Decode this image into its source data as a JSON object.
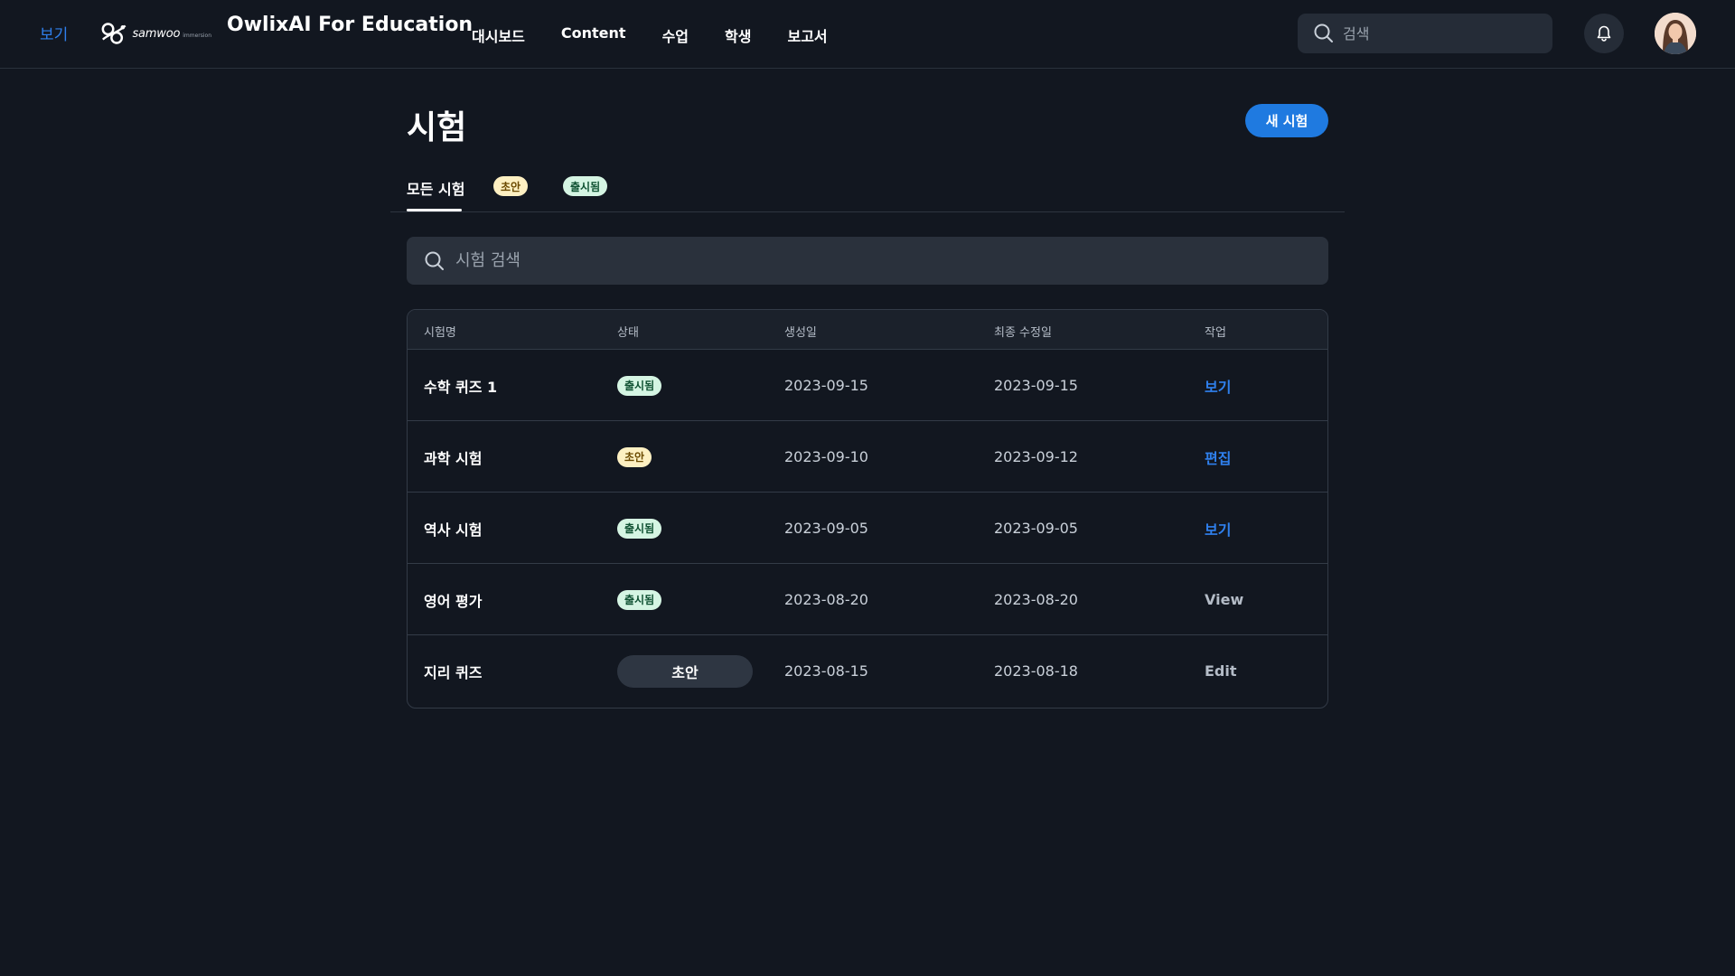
{
  "topbar": {
    "view_link": "보기",
    "logo": {
      "text": "samwoo",
      "sub": "immersion"
    },
    "app_title": "OwlixAI For Education",
    "nav": [
      "대시보드",
      "Content",
      "수업",
      "학생",
      "보고서"
    ],
    "search_placeholder": "검색"
  },
  "page": {
    "title": "시험",
    "new_button": "새 시험"
  },
  "tabs": {
    "all": "모든 시험",
    "draft": "초안",
    "published": "출시됨"
  },
  "exam_search": {
    "placeholder": "시험 검색"
  },
  "table": {
    "headers": {
      "name": "시험명",
      "status": "상태",
      "created": "생성일",
      "modified": "최종 수정일",
      "action": "작업"
    },
    "rows": [
      {
        "name": "수학 퀴즈 1",
        "status": "출시됨",
        "created": "2023-09-15",
        "modified": "2023-09-15",
        "action": "보기"
      },
      {
        "name": "과학 시험",
        "status": "초안",
        "created": "2023-09-10",
        "modified": "2023-09-12",
        "action": "편집"
      },
      {
        "name": "역사 시험",
        "status": "출시됨",
        "created": "2023-09-05",
        "modified": "2023-09-05",
        "action": "보기"
      },
      {
        "name": "영어 평가",
        "status": "출시됨",
        "created": "2023-08-20",
        "modified": "2023-08-20",
        "action": "View"
      },
      {
        "name": "지리 퀴즈",
        "status": "초안",
        "created": "2023-08-15",
        "modified": "2023-08-18",
        "action": "Edit"
      }
    ]
  },
  "colors": {
    "background": "#121720",
    "accent": "#1f7ae0",
    "link": "#2f80ed",
    "draft_badge": "#fdf0c2",
    "published_badge": "#d5f5e3"
  }
}
